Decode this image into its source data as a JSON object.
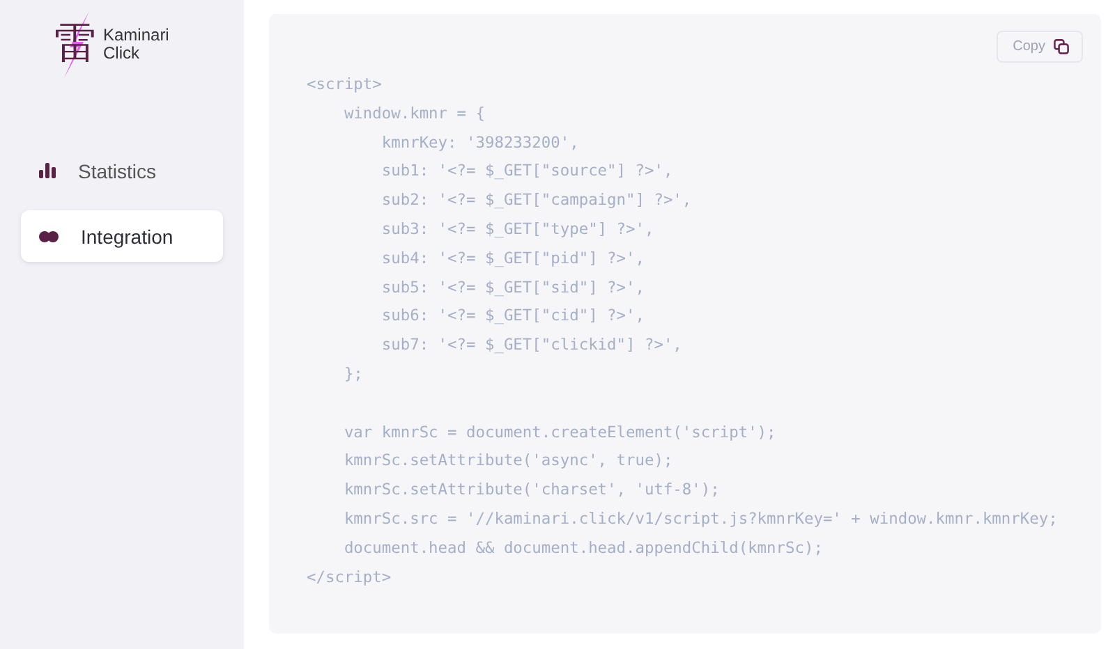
{
  "logo": {
    "glyph": "雷",
    "name_lines": [
      "Kaminari",
      "Click"
    ]
  },
  "sidebar": {
    "items": [
      {
        "label": "Statistics",
        "kind": "stats",
        "selected": false
      },
      {
        "label": "Integration",
        "kind": "integration",
        "selected": true
      }
    ]
  },
  "code_panel": {
    "copy_button": "Copy",
    "blocks": [
      [
        "<script>",
        "    window.kmnr = {",
        "        kmnrKey: '398233200',",
        "        sub1: '<?= $_GET[\"source\"] ?>',",
        "        sub2: '<?= $_GET[\"campaign\"] ?>',",
        "        sub3: '<?= $_GET[\"type\"] ?>',",
        "        sub4: '<?= $_GET[\"pid\"] ?>',",
        "        sub5: '<?= $_GET[\"sid\"] ?>',",
        "        sub6: '<?= $_GET[\"cid\"] ?>',",
        "        sub7: '<?= $_GET[\"clickid\"] ?>',",
        "    };"
      ],
      [
        "    var kmnrSc = document.createElement('script');",
        "    kmnrSc.setAttribute('async', true);",
        "    kmnrSc.setAttribute('charset', 'utf-8');",
        "    kmnrSc.src = '//kaminari.click/v1/script.js?kmnrKey=' + window.kmnr.kmnrKey;",
        "    document.head && document.head.appendChild(kmnrSc);",
        "</script>"
      ]
    ]
  }
}
